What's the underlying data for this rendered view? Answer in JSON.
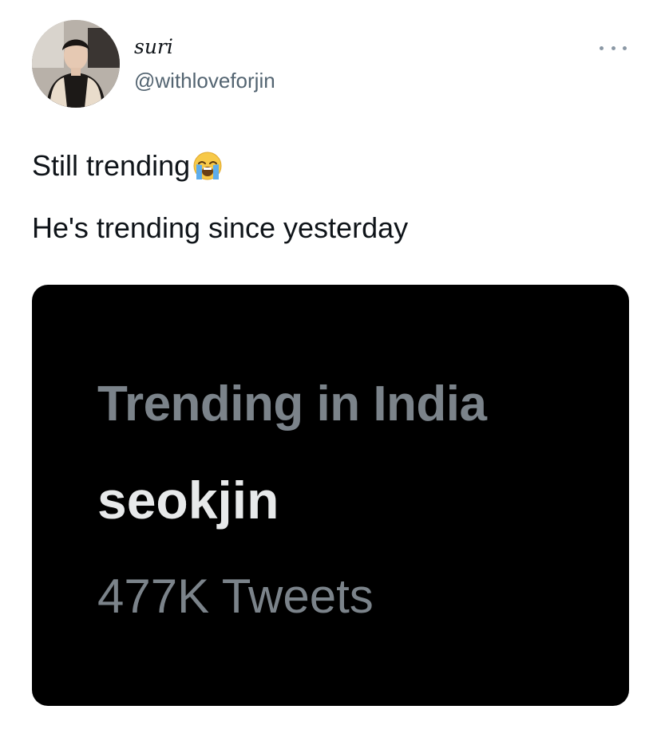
{
  "tweet": {
    "author": {
      "display_name": "suri",
      "handle": "@withloveforjin"
    },
    "text": {
      "line1": "Still trending",
      "line1_emoji": "loudly-crying-face",
      "line2": "He's trending since yesterday"
    },
    "media": {
      "heading": "Trending in India",
      "topic": "seokjin",
      "tweet_count": "477K Tweets"
    }
  },
  "icons": {
    "more": "more-horizontal-icon"
  },
  "colors": {
    "secondary_text": "#536471",
    "media_bg": "#000000",
    "media_gray": "#7b838a",
    "media_white": "#e7e9ea"
  }
}
